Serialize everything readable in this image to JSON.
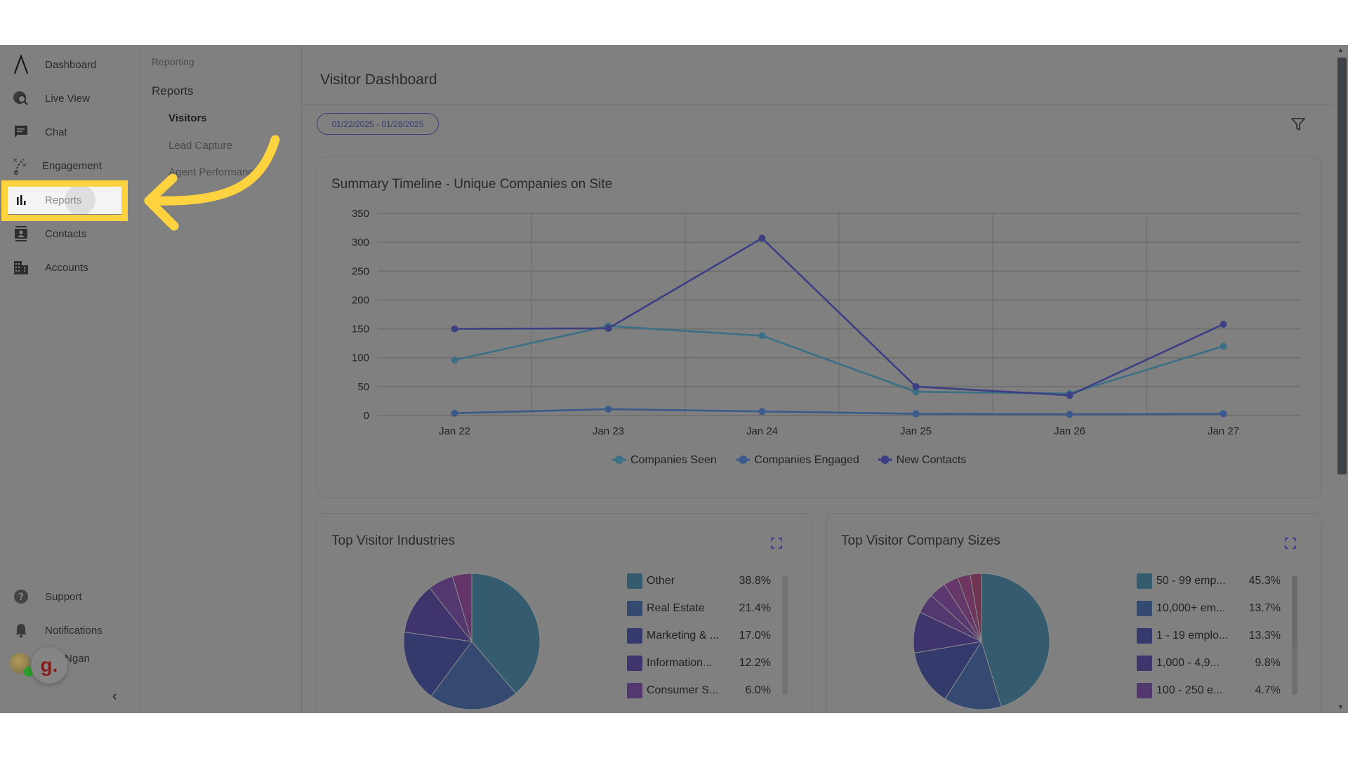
{
  "sidebar": {
    "items": [
      {
        "label": "Dashboard",
        "icon": "logo-icon"
      },
      {
        "label": "Live View",
        "icon": "live-view-icon"
      },
      {
        "label": "Chat",
        "icon": "chat-icon"
      },
      {
        "label": "Engagement",
        "icon": "engagement-icon"
      },
      {
        "label": "Reports",
        "icon": "bar-chart-icon",
        "active": true
      },
      {
        "label": "Contacts",
        "icon": "contacts-icon"
      },
      {
        "label": "Accounts",
        "icon": "accounts-icon"
      }
    ],
    "bottom_items": [
      {
        "label": "Support",
        "icon": "help-icon"
      },
      {
        "label": "Notifications",
        "icon": "bell-icon"
      }
    ],
    "user": {
      "name": "Ngan",
      "badge_letter": "g."
    },
    "collapse_glyph": "‹"
  },
  "subnav": {
    "section": "Reporting",
    "group": "Reports",
    "items": [
      {
        "label": "Visitors",
        "active": true
      },
      {
        "label": "Lead Capture"
      },
      {
        "label": "Agent Performance"
      }
    ]
  },
  "main": {
    "title": "Visitor Dashboard",
    "date_range": "01/22/2025 - 01/28/2025"
  },
  "colors": {
    "companies_seen": "#3a6f86",
    "companies_engaged": "#3a5a8c",
    "new_contacts": "#3c3f84",
    "highlight": "#ffd23f"
  },
  "chart_data": [
    {
      "type": "line",
      "title": "Summary Timeline - Unique Companies on Site",
      "xlabel": "",
      "ylabel": "",
      "categories": [
        "Jan 22",
        "Jan 23",
        "Jan 24",
        "Jan 25",
        "Jan 26",
        "Jan 27"
      ],
      "ylim": [
        0,
        350
      ],
      "yticks": [
        0,
        50,
        100,
        150,
        200,
        250,
        300,
        350
      ],
      "grid": true,
      "legend": "bottom",
      "series": [
        {
          "name": "Companies Seen",
          "values": [
            96,
            155,
            138,
            41,
            38,
            120
          ]
        },
        {
          "name": "Companies Engaged",
          "values": [
            4,
            11,
            7,
            3,
            2,
            3
          ]
        },
        {
          "name": "New Contacts",
          "values": [
            150,
            151,
            307,
            50,
            35,
            158
          ]
        }
      ]
    },
    {
      "type": "pie",
      "title": "Top Visitor Industries",
      "legend": "right",
      "slices": [
        {
          "label": "Other",
          "display": "Other",
          "value": 38.8
        },
        {
          "label": "Real Estate",
          "display": "Real Estate",
          "value": 21.4
        },
        {
          "label": "Marketing & ...",
          "display": "Marketing & ...",
          "value": 17.0
        },
        {
          "label": "Information...",
          "display": "Information...",
          "value": 12.2
        },
        {
          "label": "Consumer S...",
          "display": "Consumer S...",
          "value": 6.0
        },
        {
          "label": "(not visible)",
          "display": "",
          "value": 4.6
        }
      ]
    },
    {
      "type": "pie",
      "title": "Top Visitor Company Sizes",
      "legend": "right",
      "slices": [
        {
          "label": "50 - 99 emp...",
          "display": "50 - 99 emp...",
          "value": 45.3
        },
        {
          "label": "10,000+ em...",
          "display": "10,000+ em...",
          "value": 13.7
        },
        {
          "label": "1 - 19 emplo...",
          "display": "1 - 19 emplo...",
          "value": 13.3
        },
        {
          "label": "1,000 - 4,9...",
          "display": "1,000 - 4,9...",
          "value": 9.8
        },
        {
          "label": "100 - 250 e...",
          "display": "100 - 250 e...",
          "value": 4.7
        },
        {
          "label": "(not visible)",
          "display": "",
          "value": 4.0
        },
        {
          "label": "(not visible)",
          "display": "",
          "value": 3.5
        },
        {
          "label": "(not visible)",
          "display": "",
          "value": 3.0
        },
        {
          "label": "(not visible)",
          "display": "",
          "value": 2.7
        }
      ]
    }
  ],
  "pie_palettes": {
    "industries": [
      "#345c6e",
      "#354a70",
      "#343a6c",
      "#40346c",
      "#52386e",
      "#62346a"
    ],
    "sizes": [
      "#345c6e",
      "#354a70",
      "#343a6c",
      "#40346c",
      "#52386e",
      "#5c3870",
      "#66386a",
      "#6c3660",
      "#703450"
    ]
  }
}
